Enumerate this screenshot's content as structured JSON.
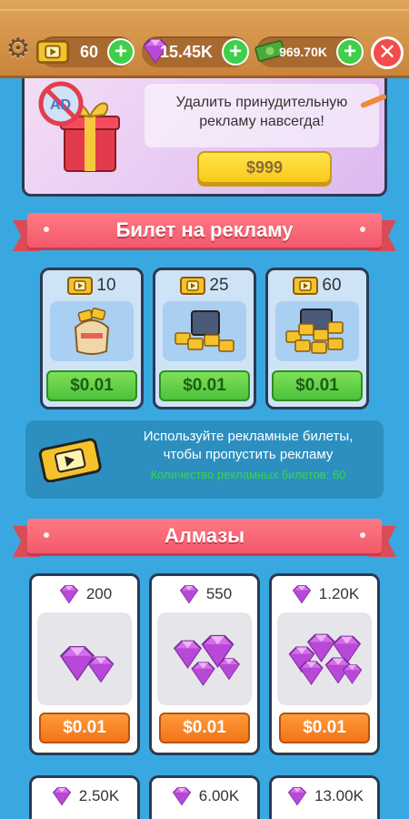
{
  "topbar": {
    "tickets": "60",
    "gems": "15.45K",
    "cash": "969.70K",
    "plus": "+",
    "close": "✕",
    "gear": "⚙"
  },
  "ads_banner": {
    "text_line1": "Удалить принудительную",
    "text_line2": "рекламу навсегда!",
    "price": "$999"
  },
  "tickets_section": {
    "title": "Билет на рекламу",
    "items": [
      {
        "amount": "10",
        "price": "$0.01"
      },
      {
        "amount": "25",
        "price": "$0.01"
      },
      {
        "amount": "60",
        "price": "$0.01"
      }
    ]
  },
  "info": {
    "line1": "Используйте рекламные билеты,",
    "line2": "чтобы пропустить рекламу",
    "count": "Количество рекламных билетов: 60"
  },
  "gems_section": {
    "title": "Алмазы",
    "items": [
      {
        "amount": "200",
        "price": "$0.01"
      },
      {
        "amount": "550",
        "price": "$0.01"
      },
      {
        "amount": "1.20K",
        "price": "$0.01"
      },
      {
        "amount": "2.50K"
      },
      {
        "amount": "6.00K"
      },
      {
        "amount": "13.00K"
      }
    ]
  },
  "colors": {
    "background": "#3aa8e0",
    "ribbon": "#f2596a",
    "green_button": "#4cc23a",
    "orange_button": "#f27418",
    "price_yellow": "#f8c91a"
  },
  "icons": [
    "gear-icon",
    "ticket-icon",
    "gem-icon",
    "cash-icon",
    "plus-icon",
    "close-icon",
    "gift-icon",
    "no-ads-icon"
  ]
}
